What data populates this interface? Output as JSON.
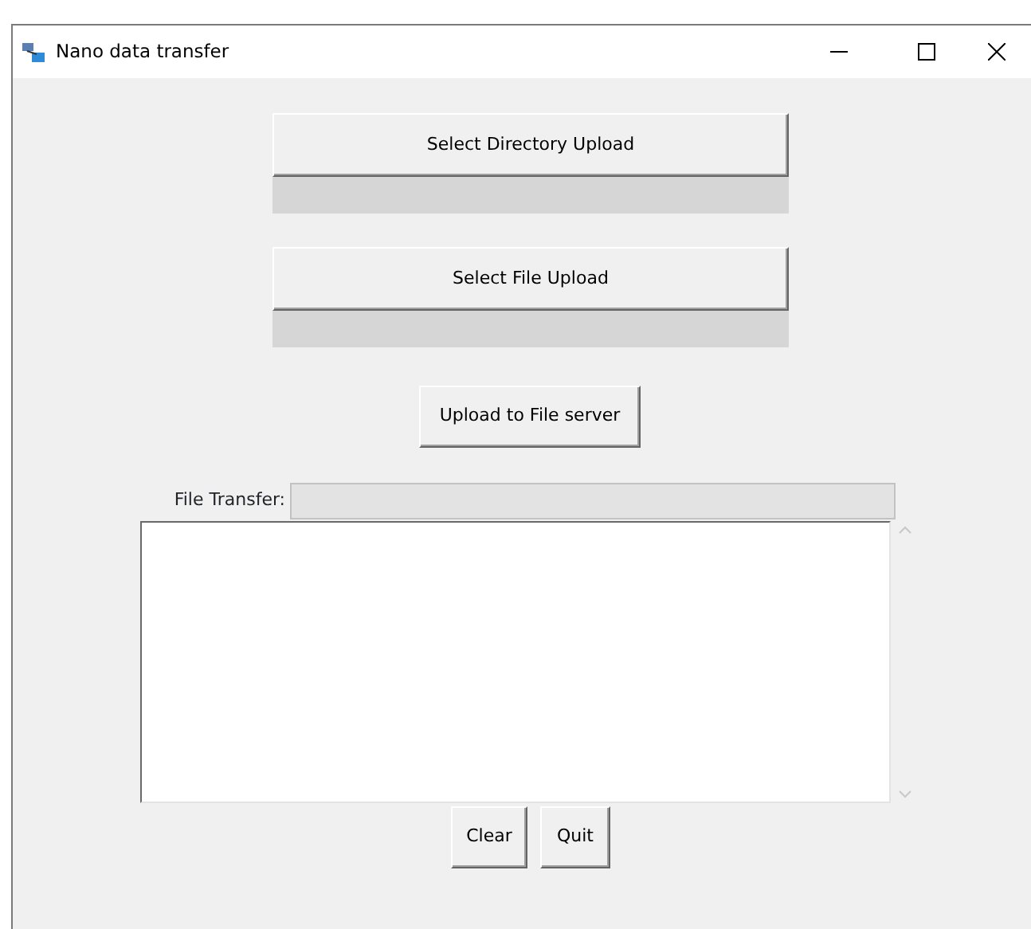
{
  "window": {
    "title": "Nano data transfer"
  },
  "uploads": [
    {
      "button": "Select Directory Upload",
      "level": 0
    },
    {
      "button": "Select File Upload",
      "level": 0
    }
  ],
  "upload_button": "Upload to File server",
  "file_transfer": {
    "label": "File Transfer:"
  },
  "buttons": [
    "Clear",
    "Quit"
  ]
}
